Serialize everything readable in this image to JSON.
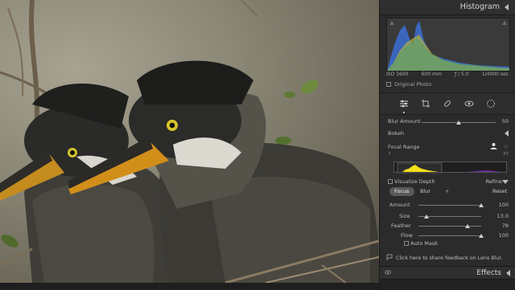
{
  "histogram": {
    "title": "Histogram",
    "iso": "ISO 1600",
    "focal_length": "600 mm",
    "aperture": "ƒ / 5.0",
    "shutter": "1/4000 sec",
    "original_photo_label": "Original Photo",
    "colors": {
      "blue": "#3b6fd6",
      "yellow": "#b8b23c",
      "green": "#4c9c6d",
      "gray": "#8a8a8a"
    }
  },
  "tools": [
    "edit-sliders-icon",
    "crop-icon",
    "healing-icon",
    "redeye-icon",
    "masking-icon"
  ],
  "lens_blur": {
    "blur_amount_label": "Blur Amount",
    "blur_amount_value": "50",
    "blur_amount_fraction": 0.5,
    "bokeh_label": "Bokeh",
    "focal_range_label": "Focal Range",
    "focal_range_min": "7",
    "focal_range_max": "47",
    "visualize_depth_label": "Visualize Depth",
    "refine_label": "Refine",
    "focus_tab": "Focus",
    "blur_tab": "Blur",
    "reset_label": "Reset",
    "amount_label": "Amount",
    "amount_value": "100",
    "amount_fraction": 1.0,
    "size_label": "Size",
    "size_value": "13.0",
    "size_fraction": 0.13,
    "feather_label": "Feather",
    "feather_value": "78",
    "feather_fraction": 0.78,
    "flow_label": "Flow",
    "flow_value": "100",
    "flow_fraction": 1.0,
    "auto_mask_label": "Auto Mask",
    "feedback_text": "Click here to share feedback on Lens Blur."
  },
  "effects": {
    "title": "Effects"
  }
}
